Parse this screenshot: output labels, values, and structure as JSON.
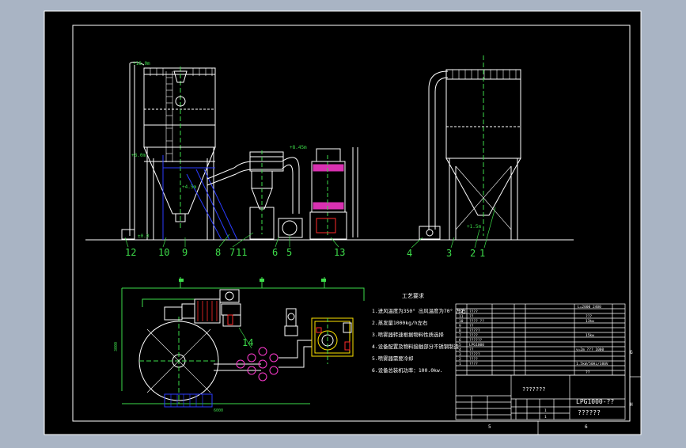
{
  "colors": {
    "background": "#a9b4c4",
    "sheet": "#000000",
    "white": "#ffffff",
    "cyan": "#3fd0e0",
    "green": "#3ddc4a",
    "blue": "#2b3cff",
    "red": "#ff2a2a",
    "yellow": "#ffe400",
    "magenta": "#ff3ad0"
  },
  "elevations": {
    "top": "+18.0m",
    "mid": "+8.0m",
    "cyclone": "+8.45m",
    "ground": "±0.0",
    "cone": "+4.5m",
    "right_outlet": "+1.5m"
  },
  "part_numbers": {
    "front": [
      "12",
      "10",
      "9",
      "8",
      "7",
      "11",
      "6",
      "5",
      "13"
    ],
    "side": [
      "4",
      "3",
      "2",
      "1"
    ],
    "plan": [
      "14"
    ]
  },
  "plan_dims": {
    "vertical": "3000",
    "horizontal": "6000"
  },
  "notes": {
    "heading": "工艺要求",
    "lines": [
      "1.进风温度为350° 出风温度为70° 左右",
      "2.蒸发量1000kg/h左右",
      "3.喷雾器转速根据物料性质选择",
      "4.设备配置及物料接触部分不锈钢制造",
      "5.喷雾器需要冷却",
      "6.设备总装机功率：100.0kw."
    ]
  },
  "title_block": {
    "drawing_no": "LPG1000-??",
    "drawing_name": "??????",
    "company": "???????",
    "right_top_text": "L=2000 2400",
    "spec_rows": [
      "???",
      "13kw",
      "15kw",
      "v=2m ??? 1000",
      "1.5kW/50Hz/380V",
      "??"
    ],
    "row_labels": [
      "12",
      "11",
      "10",
      "9",
      "8",
      "7",
      "6",
      "5",
      "4",
      "3",
      "2",
      "1"
    ],
    "row_names": [
      "????",
      "??",
      "???? ??",
      "??",
      "?????",
      "????",
      "??????",
      "LPG1000",
      "??",
      "?????",
      "????",
      "????"
    ],
    "zone_letters": [
      "G",
      "H"
    ],
    "zone_numbers": [
      "5",
      "6"
    ],
    "mini_vals": [
      "1",
      "1"
    ]
  }
}
